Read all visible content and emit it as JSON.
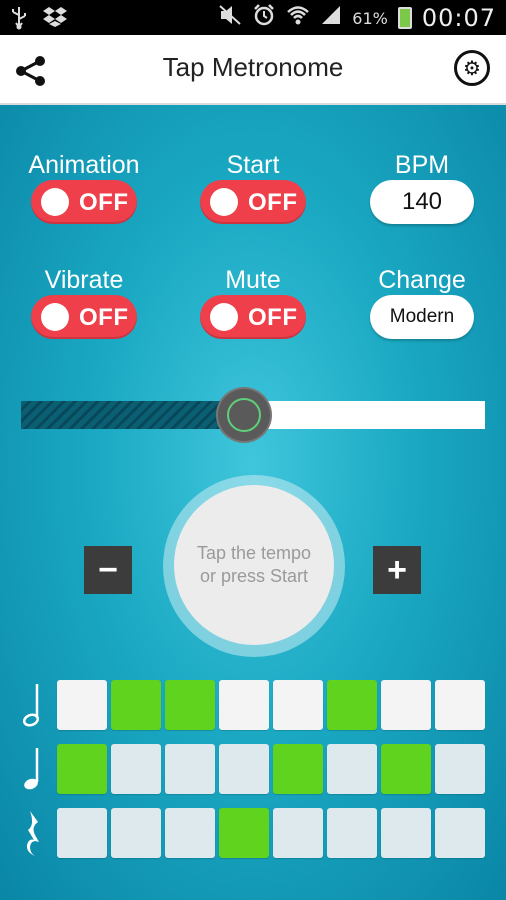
{
  "status_bar": {
    "left_icons": [
      "usb-icon",
      "dropbox-icon"
    ],
    "right_icons": [
      "mute-icon",
      "alarm-icon",
      "wifi-icon",
      "signal-icon"
    ],
    "battery": "61%",
    "time": "00:07"
  },
  "app_bar": {
    "title": "Tap Metronome",
    "share_icon": "share-icon",
    "settings_icon": "gear-icon"
  },
  "controls": {
    "animation": {
      "label": "Animation",
      "state": "OFF"
    },
    "start": {
      "label": "Start",
      "state": "OFF"
    },
    "bpm": {
      "label": "BPM",
      "value": "140"
    },
    "vibrate": {
      "label": "Vibrate",
      "state": "OFF"
    },
    "mute": {
      "label": "Mute",
      "state": "OFF"
    },
    "change": {
      "label": "Change",
      "value": "Modern"
    }
  },
  "slider": {
    "value": 0.48
  },
  "tap": {
    "line1": "Tap the tempo",
    "line2": "or press Start",
    "minus_label": "−",
    "plus_label": "+"
  },
  "beat_grid": {
    "colors": {
      "on": "#5fd31e",
      "off_row1": "#f4f4f4",
      "off_rows": "#dde9ec"
    },
    "rows": [
      {
        "icon": "half-note-icon",
        "pattern": [
          0,
          1,
          1,
          0,
          0,
          1,
          0,
          0
        ]
      },
      {
        "icon": "quarter-note-icon",
        "pattern": [
          1,
          0,
          0,
          0,
          1,
          0,
          1,
          0
        ]
      },
      {
        "icon": "rest-icon",
        "pattern": [
          0,
          0,
          0,
          1,
          0,
          0,
          0,
          0
        ]
      }
    ]
  },
  "colors": {
    "toggle_off": "#ee3f4a",
    "background": "#1aa8c2"
  }
}
